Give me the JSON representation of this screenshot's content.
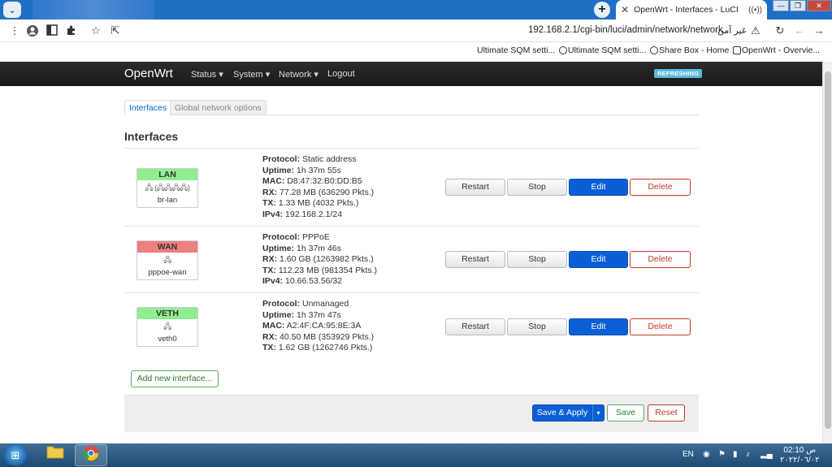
{
  "browser": {
    "tab_title": "OpenWrt - Interfaces - LuCI",
    "tab_close": "✕",
    "tab_audio": "((•))",
    "new_tab": "+",
    "tab_list": "⌄",
    "window_controls": {
      "minimize": "—",
      "restore": "❐",
      "close": "✕"
    },
    "url": "192.168.2.1/cgi-bin/luci/admin/network/network",
    "security_label": "غير آمن",
    "bookmarks": [
      {
        "label": "Ultimate SQM setti..."
      },
      {
        "label": "Ultimate SQM setti..."
      },
      {
        "label": "Share Box - Home"
      },
      {
        "label": "OpenWrt - Overvie..."
      }
    ]
  },
  "nav": {
    "brand": "OpenWrt",
    "menu": [
      {
        "label": "Status ▾"
      },
      {
        "label": "System ▾"
      },
      {
        "label": "Network ▾"
      },
      {
        "label": "Logout"
      }
    ],
    "badge": "REFRESHING"
  },
  "page": {
    "tabs": [
      {
        "label": "Interfaces",
        "active": true
      },
      {
        "label": "Global network options",
        "active": false
      }
    ],
    "section_title": "Interfaces",
    "interfaces": [
      {
        "name": "LAN",
        "header_color": "#90ee90",
        "icons": "🖧 (🖧🖧🖧🖧)",
        "device": "br-lan",
        "info": [
          {
            "label": "Protocol:",
            "value": " Static address"
          },
          {
            "label": "Uptime:",
            "value": " 1h 37m 55s"
          },
          {
            "label": "MAC:",
            "value": " D8:47:32:B0:DD:B5"
          },
          {
            "label": "RX:",
            "value": " 77.28 MB (636290 Pkts.)"
          },
          {
            "label": "TX:",
            "value": " 1.33 MB (4032 Pkts.)"
          },
          {
            "label": "IPv4:",
            "value": " 192.168.2.1/24"
          }
        ]
      },
      {
        "name": "WAN",
        "header_color": "#f08080",
        "icons": "🖧",
        "device": "pppoe-wan",
        "info": [
          {
            "label": "Protocol:",
            "value": " PPPoE"
          },
          {
            "label": "Uptime:",
            "value": " 1h 37m 46s"
          },
          {
            "label": "RX:",
            "value": " 1.60 GB (1263982 Pkts.)"
          },
          {
            "label": "TX:",
            "value": " 112.23 MB (981354 Pkts.)"
          },
          {
            "label": "IPv4:",
            "value": " 10.66.53.56/32"
          }
        ]
      },
      {
        "name": "VETH",
        "header_color": "#90ee90",
        "icons": "🖧",
        "device": "veth0",
        "info": [
          {
            "label": "Protocol:",
            "value": " Unmanaged"
          },
          {
            "label": "Uptime:",
            "value": " 1h 37m 47s"
          },
          {
            "label": "MAC:",
            "value": " A2:4F:CA:95:8E:3A"
          },
          {
            "label": "RX:",
            "value": " 40.50 MB (353929 Pkts.)"
          },
          {
            "label": "TX:",
            "value": " 1.62 GB (1262746 Pkts.)"
          }
        ]
      }
    ],
    "row_buttons": {
      "restart": "Restart",
      "stop": "Stop",
      "edit": "Edit",
      "delete": "Delete"
    },
    "add_interface": "Add new interface...",
    "footer": {
      "save_apply": "Save & Apply",
      "caret": "▾",
      "save": "Save",
      "reset": "Reset"
    }
  },
  "taskbar": {
    "start": "⊞",
    "language": "EN",
    "time": "02:10 ص",
    "date": "٢٠٢٢/٠٦/٠٢",
    "tray_icons": [
      "network-icon",
      "flag-icon",
      "battery-icon",
      "speaker-icon",
      "signal-icon"
    ]
  }
}
